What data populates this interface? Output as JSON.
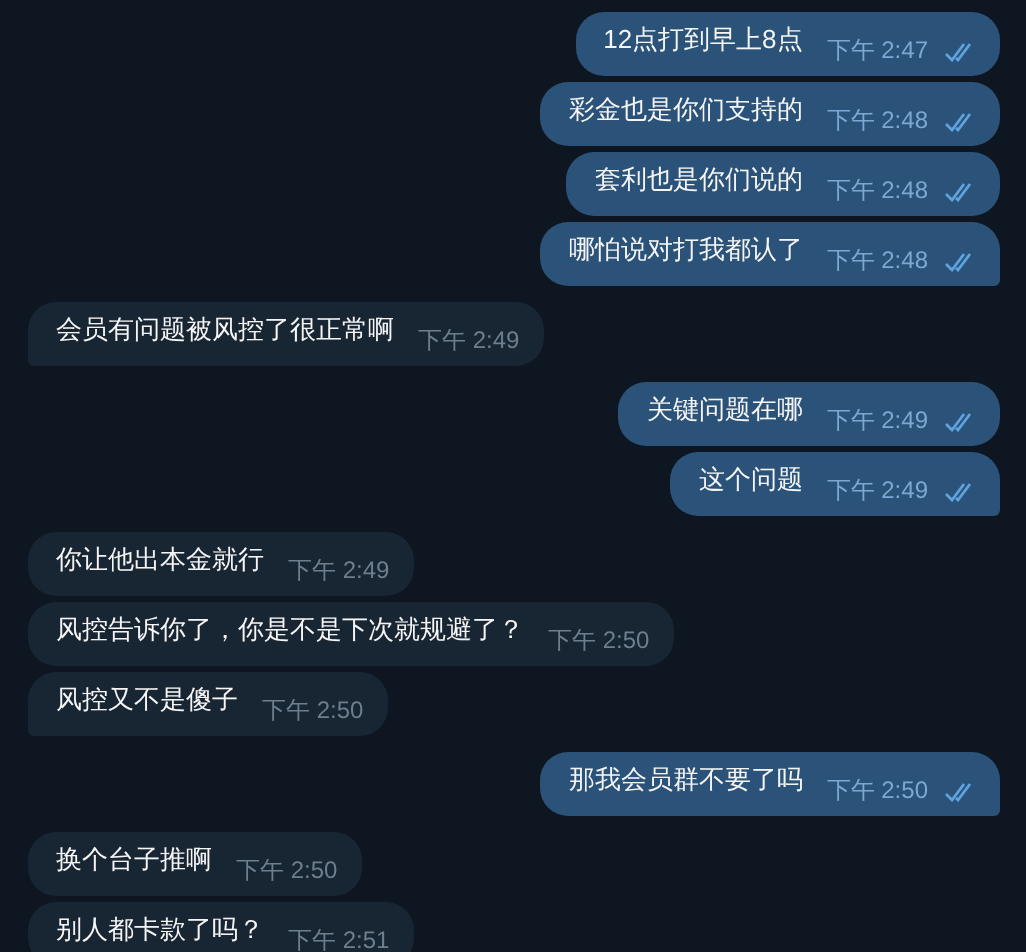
{
  "messages": [
    {
      "kind": "outgoing",
      "text": "12点打到早上8点",
      "time": "下午 2:47",
      "read": true,
      "tail": false
    },
    {
      "kind": "outgoing",
      "text": "彩金也是你们支持的",
      "time": "下午 2:48",
      "read": true,
      "tail": false
    },
    {
      "kind": "outgoing",
      "text": "套利也是你们说的",
      "time": "下午 2:48",
      "read": true,
      "tail": false
    },
    {
      "kind": "outgoing",
      "text": "哪怕说对打我都认了",
      "time": "下午 2:48",
      "read": true,
      "tail": true
    },
    {
      "kind": "incoming",
      "text": "会员有问题被风控了很正常啊",
      "time": "下午 2:49",
      "tail": true
    },
    {
      "kind": "outgoing",
      "text": "关键问题在哪",
      "time": "下午 2:49",
      "read": true,
      "tail": false
    },
    {
      "kind": "outgoing",
      "text": "这个问题",
      "time": "下午 2:49",
      "read": true,
      "tail": true
    },
    {
      "kind": "incoming",
      "text": "你让他出本金就行",
      "time": "下午 2:49",
      "tail": false
    },
    {
      "kind": "incoming",
      "text": "风控告诉你了，你是不是下次就规避了？",
      "time": "下午 2:50",
      "tail": false
    },
    {
      "kind": "incoming",
      "text": "风控又不是傻子",
      "time": "下午 2:50",
      "tail": true
    },
    {
      "kind": "outgoing",
      "text": "那我会员群不要了吗",
      "time": "下午 2:50",
      "read": true,
      "tail": true
    },
    {
      "kind": "incoming",
      "text": "换个台子推啊",
      "time": "下午 2:50",
      "tail": false
    },
    {
      "kind": "incoming",
      "text": "别人都卡款了吗？",
      "time": "下午 2:51",
      "tail": false
    }
  ]
}
